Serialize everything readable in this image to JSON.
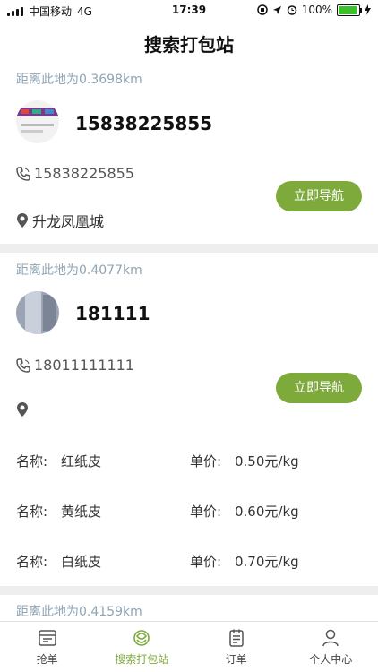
{
  "status_bar": {
    "carrier": "中国移动",
    "network": "4G",
    "time": "17:39",
    "battery": "100%"
  },
  "page": {
    "title": "搜索打包站"
  },
  "stations": [
    {
      "distance": "距离此地为0.3698km",
      "name": "15838225855",
      "phone": "15838225855",
      "address": "升龙凤凰城",
      "nav_label": "立即导航"
    },
    {
      "distance": "距离此地为0.4077km",
      "name": "181111",
      "phone": "18011111111",
      "address": "",
      "nav_label": "立即导航",
      "materials": [
        {
          "name_label": "名称:",
          "name": "红纸皮",
          "price_label": "单价:",
          "price": "0.50元/kg"
        },
        {
          "name_label": "名称:",
          "name": "黄纸皮",
          "price_label": "单价:",
          "price": "0.60元/kg"
        },
        {
          "name_label": "名称:",
          "name": "白纸皮",
          "price_label": "单价:",
          "price": "0.70元/kg"
        }
      ]
    },
    {
      "distance": "距离此地为0.4159km"
    }
  ],
  "tabs": [
    {
      "label": "抢单",
      "icon": "grab-order-icon",
      "active": false
    },
    {
      "label": "搜索打包站",
      "icon": "search-station-icon",
      "active": true
    },
    {
      "label": "订单",
      "icon": "order-icon",
      "active": false
    },
    {
      "label": "个人中心",
      "icon": "user-center-icon",
      "active": false
    }
  ],
  "colors": {
    "accent": "#7eaa3c",
    "distance_text": "#8fa5b5",
    "separator": "#eeeeee"
  }
}
